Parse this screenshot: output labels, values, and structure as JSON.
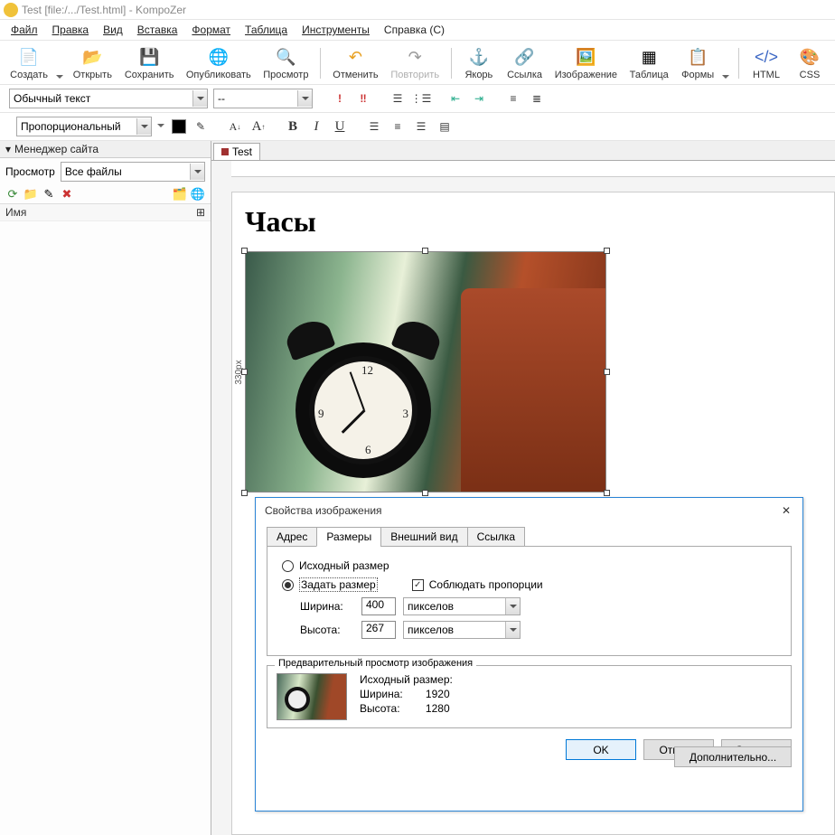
{
  "window_title": "Test [file:/.../Test.html] - KompoZer",
  "menu": {
    "file": "Файл",
    "edit": "Правка",
    "view": "Вид",
    "insert": "Вставка",
    "format": "Формат",
    "table": "Таблица",
    "tools": "Инструменты",
    "help": "Справка (С)"
  },
  "toolbar": {
    "create": "Создать",
    "open": "Открыть",
    "save": "Сохранить",
    "publish": "Опубликовать",
    "preview": "Просмотр",
    "undo": "Отменить",
    "redo": "Повторить",
    "anchor": "Якорь",
    "link": "Ссылка",
    "image": "Изображение",
    "table": "Таблица",
    "forms": "Формы",
    "html": "HTML",
    "css": "CSS"
  },
  "format1": {
    "para_style": "Обычный текст",
    "dashes": "--"
  },
  "format2": {
    "font_family": "Пропорциональный"
  },
  "sidebar": {
    "title": "Менеджер сайта",
    "view_label": "Просмотр",
    "view_value": "Все файлы",
    "name_col": "Имя"
  },
  "doc": {
    "tab": "Test",
    "heading": "Часы",
    "img_h_label": "330px"
  },
  "dialog": {
    "title": "Свойства изображения",
    "tabs": {
      "address": "Адрес",
      "size": "Размеры",
      "appearance": "Внешний вид",
      "link": "Ссылка"
    },
    "orig_size": "Исходный размер",
    "set_size": "Задать размер",
    "keep_ratio": "Соблюдать пропорции",
    "width_l": "Ширина:",
    "width_v": "400",
    "width_u": "пикселов",
    "height_l": "Высота:",
    "height_v": "267",
    "height_u": "пикселов",
    "preview_legend": "Предварительный просмотр изображения",
    "pv_orig": "Исходный размер:",
    "pv_w_l": "Ширина:",
    "pv_w_v": "1920",
    "pv_h_l": "Высота:",
    "pv_h_v": "1280",
    "extra": "Дополнительно...",
    "ok": "OK",
    "cancel": "Отмена",
    "help": "Справка"
  }
}
